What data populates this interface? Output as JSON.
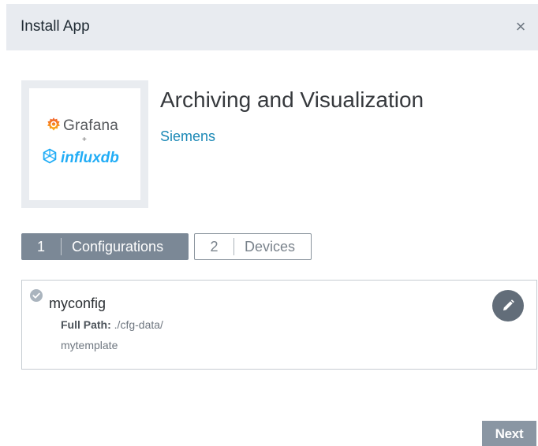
{
  "dialog": {
    "title": "Install App",
    "close_icon": "close-icon",
    "close_glyph": "×"
  },
  "app": {
    "logo": {
      "grafana_text": "Grafana",
      "plus": "+",
      "influx_text": "influxdb"
    },
    "title": "Archiving and Visualization",
    "vendor": "Siemens"
  },
  "steps": [
    {
      "number": "1",
      "label": "Configurations",
      "active": true
    },
    {
      "number": "2",
      "label": "Devices",
      "active": false
    }
  ],
  "config": {
    "name": "myconfig",
    "path_label": "Full Path:",
    "path_value": "./cfg-data/",
    "path_continuation": "mytemplate",
    "status_icon": "check-circle-icon",
    "edit_icon": "pencil-icon"
  },
  "footer": {
    "next_label": "Next"
  },
  "colors": {
    "header_bg": "#e8ebf0",
    "accent_link": "#1c89b6",
    "step_active_bg": "#7b8896",
    "edit_button_bg": "#626d79",
    "next_button_bg": "#8a96a3",
    "grafana_orange": "#f46800",
    "influx_blue": "#22adf6"
  }
}
